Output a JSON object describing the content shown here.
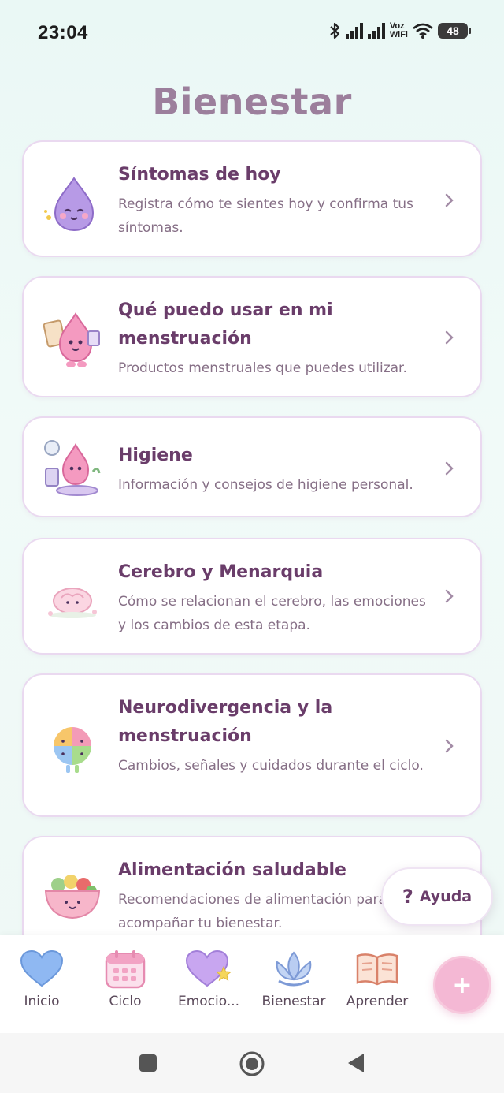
{
  "status_bar": {
    "time": "23:04",
    "voz_line1": "Voz",
    "voz_line2": "WiFi",
    "battery": "48"
  },
  "header": {
    "title": "Bienestar"
  },
  "cards": [
    {
      "title": "Síntomas de hoy",
      "description": "Registra cómo te sientes hoy y confirma tus síntomas.",
      "icon": "purple-drop-mascot-icon"
    },
    {
      "title": "Qué puedo usar en mi menstruación",
      "description": "Productos menstruales que puedes utilizar.",
      "icon": "pink-drop-clipboard-icon"
    },
    {
      "title": "Higiene",
      "description": "Información y consejos de higiene personal.",
      "icon": "hygiene-mascot-icon"
    },
    {
      "title": "Cerebro y Menarquia",
      "description": "Cómo se relacionan el cerebro, las emociones y los cambios de esta etapa.",
      "icon": "brain-mascot-icon"
    },
    {
      "title": "Neurodivergencia y la menstruación",
      "description": "Cambios, señales y cuidados durante el ciclo.",
      "icon": "puzzle-brain-icon"
    },
    {
      "title": "Alimentación saludable",
      "description": "Recomendaciones de alimentación para acompañar tu bienestar.",
      "icon": "salad-bowl-icon"
    }
  ],
  "help_button": {
    "label": "Ayuda",
    "icon": "question-icon"
  },
  "bottom_nav": {
    "items": [
      {
        "label": "Inicio",
        "icon": "blue-heart-icon"
      },
      {
        "label": "Ciclo",
        "icon": "calendar-icon"
      },
      {
        "label": "Emocio...",
        "icon": "purple-heart-star-icon"
      },
      {
        "label": "Bienestar",
        "icon": "lotus-icon",
        "active": true
      },
      {
        "label": "Aprender",
        "icon": "book-icon"
      }
    ],
    "fab_symbol": "+"
  },
  "colors": {
    "background": "#eaf8f5",
    "title": "#9c7f9c",
    "card_title": "#6a3d6a",
    "card_border": "#ead9f0",
    "fab": "#f4b8d4"
  }
}
